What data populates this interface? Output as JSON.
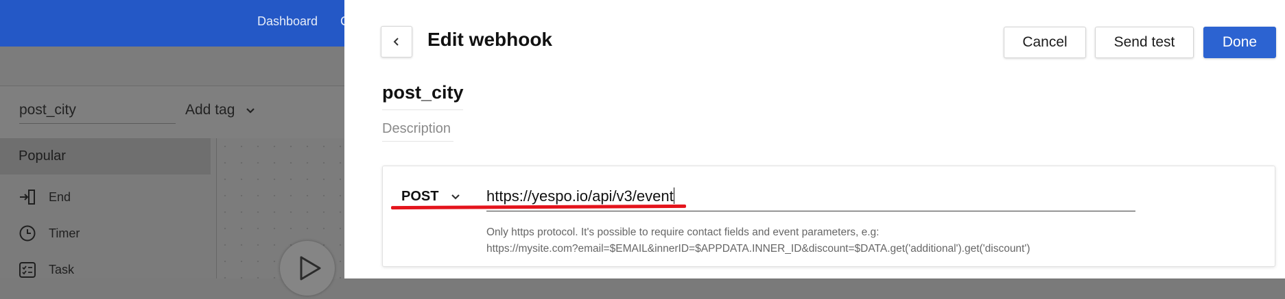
{
  "background": {
    "nav_item_1": "Dashboard",
    "nav_item_2": "C",
    "workflow_name": "post_city",
    "add_tag_label": "Add tag",
    "popular_label": "Popular",
    "blocks": [
      {
        "label": "End",
        "icon": "end-icon"
      },
      {
        "label": "Timer",
        "icon": "clock-icon"
      },
      {
        "label": "Task",
        "icon": "task-icon"
      }
    ]
  },
  "panel": {
    "title": "Edit webhook",
    "buttons": {
      "cancel": "Cancel",
      "send_test": "Send test",
      "done": "Done"
    },
    "webhook_name": "post_city",
    "description_placeholder": "Description",
    "method": "POST",
    "url": "https://yespo.io/api/v3/event",
    "hint_line_1": "Only https protocol. It's possible to require contact fields and event parameters, e.g:",
    "hint_line_2": "https://mysite.com?email=$EMAIL&innerID=$APPDATA.INNER_ID&discount=$DATA.get('additional').get('discount')"
  },
  "colors": {
    "primary": "#2c63d1",
    "header_blue": "#2458c6",
    "annotation_red": "#e4141c"
  }
}
